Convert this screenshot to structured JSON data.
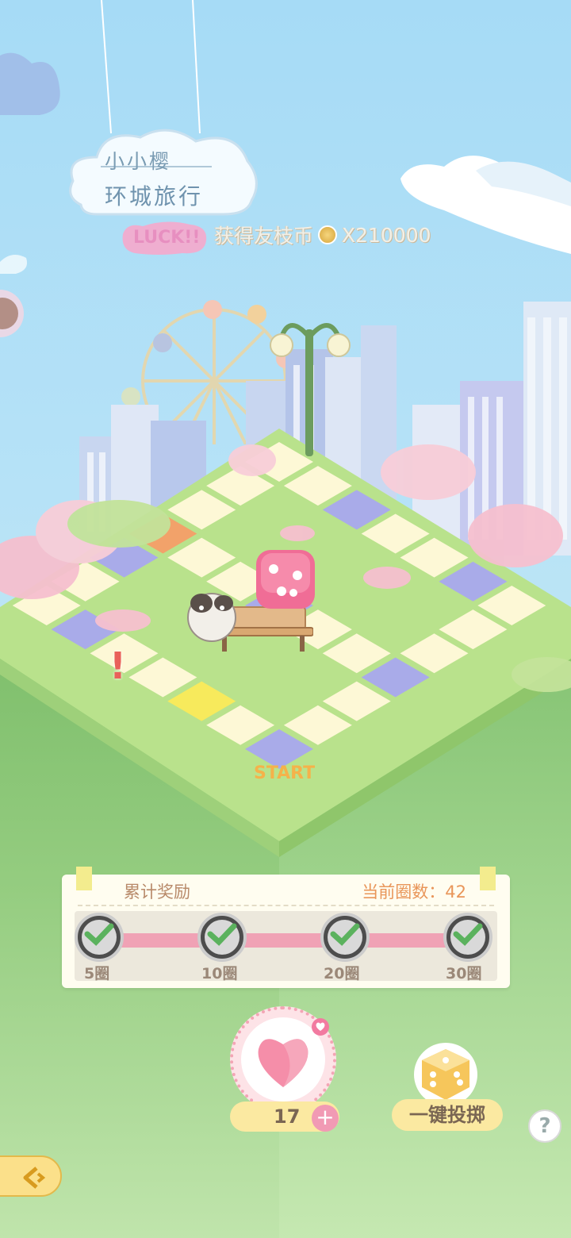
{
  "sign": {
    "line1": "小小樱",
    "line2": "环城旅行"
  },
  "luck_badge": "LUCK!!",
  "reward": {
    "text": "获得友枝币",
    "amount": "X210000"
  },
  "board": {
    "start_label": "START",
    "alert_mark": "!"
  },
  "panel": {
    "title": "累计奖励",
    "laps_label": "当前圈数：42",
    "milestones": [
      {
        "label": "5圈",
        "claimed": true
      },
      {
        "label": "10圈",
        "claimed": true
      },
      {
        "label": "20圈",
        "claimed": true
      },
      {
        "label": "30圈",
        "claimed": true
      }
    ]
  },
  "controls": {
    "dice_count": "17",
    "plus": "+",
    "auto_roll": "一键投掷",
    "help": "?"
  },
  "icons": [
    "heart-icon",
    "dice-icon",
    "help-icon",
    "back-icon",
    "check-icon",
    "coin-icon"
  ],
  "colors": {
    "sky": "#a6dbf6",
    "grass": "#b8e08a",
    "tile_cream": "#fdf8d6",
    "tile_blue": "#a9abe9",
    "tile_orange": "#f2a26a",
    "tile_yellow": "#f7ea5c",
    "pink": "#f19ab4"
  }
}
